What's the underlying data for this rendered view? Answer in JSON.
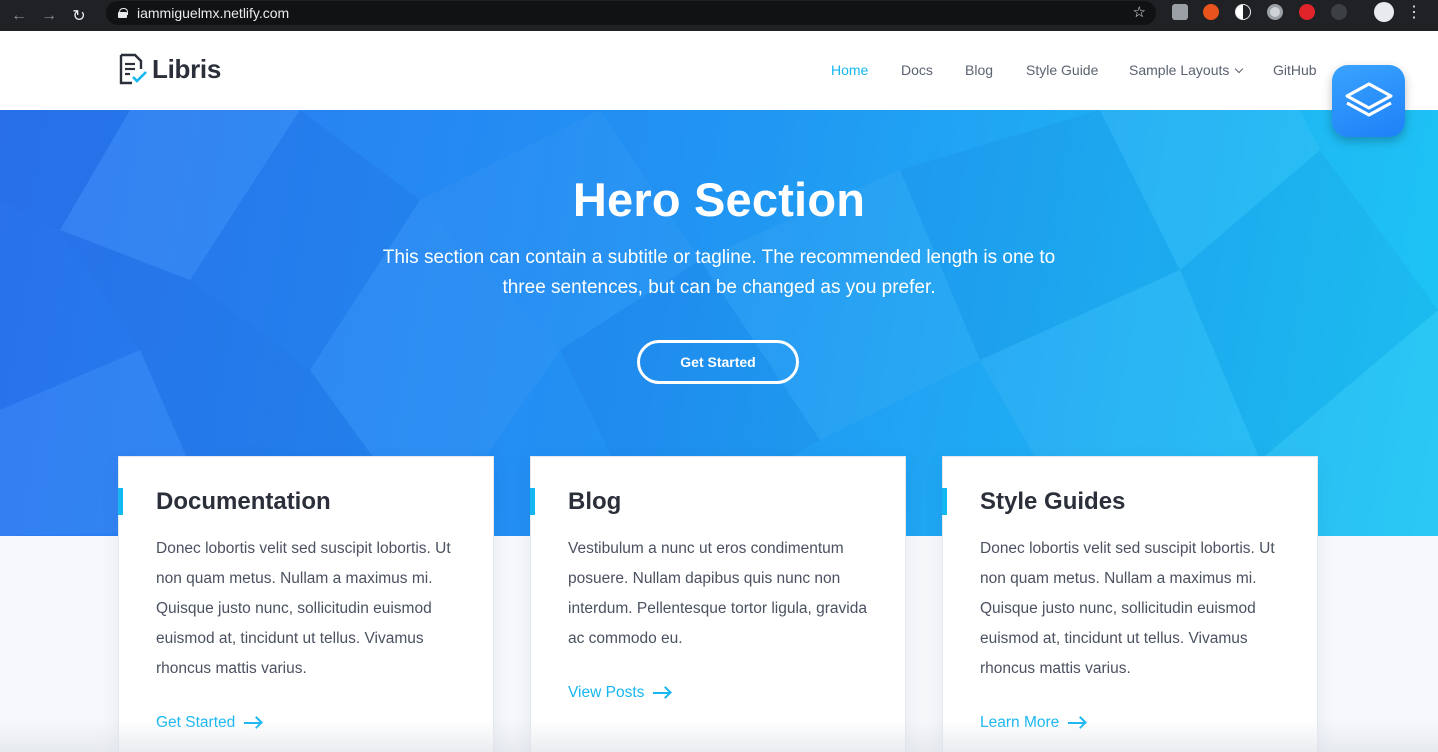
{
  "browser": {
    "url": "iammiguelmx.netlify.com",
    "back_icon": "back-arrow-icon",
    "forward_icon": "forward-arrow-icon",
    "reload_icon": "reload-icon",
    "bookmark_icon": "star-icon",
    "menu_icon": "kebab-menu-icon"
  },
  "header": {
    "logo_text": "Libris",
    "nav": [
      {
        "label": "Home",
        "active": true
      },
      {
        "label": "Docs"
      },
      {
        "label": "Blog"
      },
      {
        "label": "Style Guide"
      },
      {
        "label": "Sample Layouts"
      },
      {
        "label": "GitHub"
      }
    ]
  },
  "hero": {
    "title": "Hero Section",
    "subtitle": "This section can contain a subtitle or tagline. The recommended length is one to three sentences, but can be changed as you prefer.",
    "button_label": "Get Started"
  },
  "cards": [
    {
      "title": "Documentation",
      "text": "Donec lobortis velit sed suscipit lobortis. Ut non quam metus. Nullam a maximus mi. Quisque justo nunc, sollicitudin euismod euismod at, tincidunt ut tellus. Vivamus rhoncus mattis varius.",
      "link": "Get Started"
    },
    {
      "title": "Blog",
      "text": "Vestibulum a nunc ut eros condimentum posuere. Nullam dapibus quis nunc non interdum. Pellentesque tortor ligula, gravida ac commodo eu.",
      "link": "View Posts"
    },
    {
      "title": "Style Guides",
      "text": "Donec lobortis velit sed suscipit lobortis. Ut non quam metus. Nullam a maximus mi. Quisque justo nunc, sollicitudin euismod euismod at, tincidunt ut tellus. Vivamus rhoncus mattis varius.",
      "link": "Learn More"
    }
  ],
  "colors": {
    "accent": "#16b6f0",
    "hero_start": "#2d78f2",
    "hero_end": "#1dc6f4",
    "text_dark": "#2a2f3a"
  }
}
